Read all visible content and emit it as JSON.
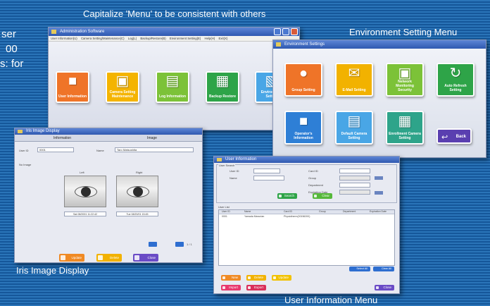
{
  "captions": {
    "top": "Capitalize 'Menu' to be consistent with others",
    "env": "Environment Setting Menu",
    "iris": "Iris Image Display",
    "user": "User Information Menu"
  },
  "left_text": [
    "ser",
    "00",
    "s: for"
  ],
  "admin_window": {
    "title": "Administration Software",
    "menu": [
      "User Information(U)",
      "Camera Setting/Maintenance(C)",
      "Log(L)",
      "Backup/Restore(B)",
      "Environment Setting(E)",
      "Help(H)",
      "Exit(X)"
    ],
    "tiles": [
      {
        "label": "User Information",
        "icon": "user-info-icon",
        "color": "#ef7428"
      },
      {
        "label": "Camera Setting Maintenance",
        "icon": "camera-tools-icon",
        "color": "#f4b400"
      },
      {
        "label": "Log Information",
        "icon": "log-icon",
        "color": "#7cc238"
      },
      {
        "label": "Backup Restore",
        "icon": "backup-icon",
        "color": "#2ea448"
      },
      {
        "label": "Environment Setting",
        "icon": "environment-icon",
        "color": "#49a6e6"
      }
    ]
  },
  "env_window": {
    "title": "Environment Settings",
    "tiles": [
      {
        "label": "Group Setting",
        "icon": "group-icon",
        "color": "#ef7428"
      },
      {
        "label": "E-Mail Setting",
        "icon": "email-icon",
        "color": "#f2b200"
      },
      {
        "label": "Network Monitoring Security",
        "icon": "network-icon",
        "color": "#7cc238"
      },
      {
        "label": "Auto Refresh Setting",
        "icon": "refresh-icon",
        "color": "#2ea448"
      },
      {
        "label": "Operator's Information",
        "icon": "operator-icon",
        "color": "#2e7fd6"
      },
      {
        "label": "Default Camera Setting",
        "icon": "camera-icon",
        "color": "#49a6e6"
      },
      {
        "label": "Enrollment Camera Setting",
        "icon": "enroll-camera-icon",
        "color": "#2ea48a"
      },
      {
        "label": "Back",
        "icon": "back-arrow-icon",
        "color": "#5a3fb0"
      }
    ]
  },
  "iris_window": {
    "title": "Iris Image Display",
    "tabs": [
      "Information",
      "Image"
    ],
    "user_id_label": "User ID",
    "user_id": "0001",
    "name_label": "Name",
    "name": "Taro Matsushita",
    "no_image_label": "No Image",
    "left_label": "Left",
    "right_label": "Right",
    "left_date": "Sat 08/2001 11:22:42",
    "right_date": "Tue 08/20/01 15:45",
    "page": "1 / 1",
    "buttons": [
      "Update",
      "Delete",
      "Close"
    ]
  },
  "user_window": {
    "title": "User Information",
    "search_label": "User Search",
    "left_fields": [
      "User ID",
      "Name"
    ],
    "right_fields": [
      "Card ID",
      "Group",
      "Department",
      "Expiration Date"
    ],
    "search_button": "Search",
    "clear_button": "Clear",
    "list_label": "User List",
    "columns": [
      "User ID",
      "Name",
      "Card ID",
      "Group",
      "Department",
      "Expiration Date"
    ],
    "rows": [
      [
        "0001",
        "Yamada Manorian",
        "Physiotherm(00156200)",
        "",
        "",
        ""
      ]
    ],
    "list_buttons": [
      "Select All",
      "Clear All"
    ],
    "bottom_buttons": [
      "New",
      "Delete",
      "Update",
      "Import",
      "Export",
      "Close"
    ]
  }
}
